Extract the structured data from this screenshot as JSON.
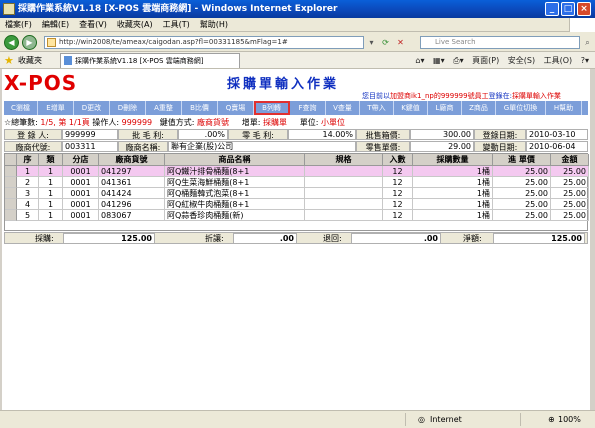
{
  "window": {
    "title": "採購作業系統V1.18 [X-POS 雲端商務網] - Windows Internet Explorer"
  },
  "menu": [
    "檔案(F)",
    "編輯(E)",
    "查看(V)",
    "收藏夾(A)",
    "工具(T)",
    "幫助(H)"
  ],
  "address": {
    "url": "http://win2008/te/ameax/caigodan.asp?fl=00331185&mFlag=1#",
    "search_placeholder": "Live Search"
  },
  "favorites": {
    "label": "收藏夾",
    "tab_title": "採購作業系統V1.18 [X-POS 雲端商務網]",
    "commands": [
      "頁面(P)",
      "安全(S)",
      "工具(O)"
    ]
  },
  "app": {
    "logo": "X-POS",
    "title": "採購單輸入作業",
    "user_info_prefix": "您目前以",
    "user_info_shop": "加盟商ik1_np的",
    "user_info_emp": "999999號員工",
    "user_info_mid": "登錄在:",
    "user_info_loc": "採購單輸入作業"
  },
  "fkeys": [
    "C瀏檔",
    "E增單",
    "D更改",
    "D刪除",
    "A重整",
    "B比價",
    "Q賣場",
    "B列轉",
    "F查詢",
    "V查量",
    "T帶入",
    "K鍵值",
    "L廠商",
    "Z商品",
    "G單位切換",
    "H幫助"
  ],
  "fkeys_selected": 7,
  "status": {
    "total_label": "☆總筆數:",
    "pages": "1/5, 第 1/1頁",
    "operator_label": "操作人:",
    "operator": "999999",
    "keymode_label": "鍵值方式:",
    "keymode": "廠商貨號",
    "add_label": "增單:",
    "add_value": "採購單",
    "unit_label": "單位:",
    "unit_value": "小單位"
  },
  "form": {
    "registrar_label": "登 錄 人:",
    "registrar": "999999",
    "gross_label": "批 毛 利:",
    "gross": ".00%",
    "retail_gross_label": "零 毛 利:",
    "retail_gross": "14.00%",
    "batch_price_label": "批售箱價:",
    "batch_price": "300.00",
    "login_date_label": "登錄日期:",
    "login_date": "2010-03-10",
    "vendor_code_label": "廠商代號:",
    "vendor_code": "003311",
    "vendor_name_label": "廠商名稱:",
    "vendor_name": "聯有企業(股)公司",
    "retail_price_label": "零售單價:",
    "retail_price": "29.00",
    "change_date_label": "變動日期:",
    "change_date": "2010-06-04"
  },
  "table": {
    "headers": [
      "序",
      "類",
      "分店",
      "廠商貨號",
      "商品名稱",
      "規格",
      "入數",
      "採購數量",
      "進 單價",
      "金額"
    ],
    "rows": [
      [
        "1",
        "1",
        "0001",
        "041297",
        "阿Q鐵汁排骨桶麵(8+1",
        "",
        "12",
        "1桶",
        "25.00",
        "25.00"
      ],
      [
        "2",
        "1",
        "0001",
        "041361",
        "阿Q生菜海鮮桶麵(8+1",
        "",
        "12",
        "1桶",
        "25.00",
        "25.00"
      ],
      [
        "3",
        "1",
        "0001",
        "041424",
        "阿Q桶麵韓式泡菜(8+1",
        "",
        "12",
        "1桶",
        "25.00",
        "25.00"
      ],
      [
        "4",
        "1",
        "0001",
        "041296",
        "阿Q紅椒牛肉桶麵(8+1",
        "",
        "12",
        "1桶",
        "25.00",
        "25.00"
      ],
      [
        "5",
        "1",
        "0001",
        "083067",
        "阿Q蒜香珍肉桶麵(新)",
        "",
        "12",
        "1桶",
        "25.00",
        "25.00"
      ]
    ],
    "selected_row": 0
  },
  "totals": {
    "purchase_label": "採購:",
    "purchase": "125.00",
    "discount_label": "折讓:",
    "discount": ".00",
    "return_label": "退回:",
    "return": ".00",
    "net_label": "淨額:",
    "net": "125.00"
  },
  "statusbar": {
    "zone": "Internet",
    "zoom": "100%"
  }
}
